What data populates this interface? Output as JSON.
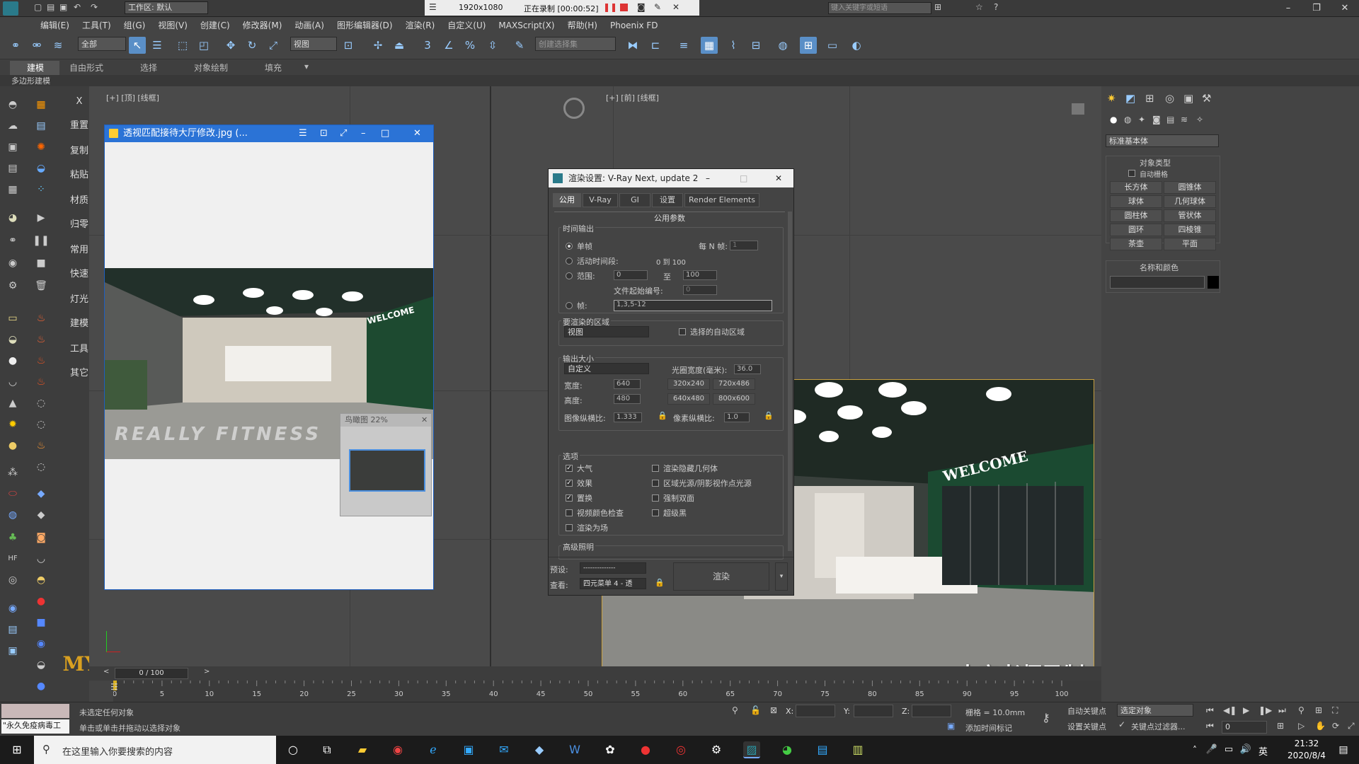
{
  "titlebar": {
    "workspace_label": "工作区: 默认",
    "resolution": "1920x1080",
    "recording": "正在录制 [00:00:52]",
    "search_placeholder": "键入关键字或短语"
  },
  "menus": [
    "编辑(E)",
    "工具(T)",
    "组(G)",
    "视图(V)",
    "创建(C)",
    "修改器(M)",
    "动画(A)",
    "图形编辑器(D)",
    "渲染(R)",
    "自定义(U)",
    "MAXScript(X)",
    "帮助(H)",
    "Phoenix FD"
  ],
  "toolbar": {
    "filter_value": "全部",
    "ref_coord_value": "视图",
    "selection_set_placeholder": "创建选择集"
  },
  "ribbon": {
    "tabs": [
      "建模",
      "自由形式",
      "选择",
      "对象绘制",
      "填充"
    ],
    "subtitle": "多边形建模"
  },
  "left_labels": [
    "重置",
    "复制",
    "粘贴",
    "材质",
    "归零",
    "常用",
    "快速",
    "灯光",
    "建模",
    "工具",
    "其它"
  ],
  "left_close": "X",
  "viewport": {
    "left_label": "[+] [顶] [线框]",
    "right_label": "[+] [前] [线框]",
    "watermark": "大宇老师录制",
    "logo": "MY"
  },
  "image_window": {
    "title": "透视匹配接待大厅修改.jpg  (...",
    "navigator_title": "鸟瞰图 22%",
    "scene_text": "REALLY FITNESS",
    "scene_welcome": "WELCOME"
  },
  "vray": {
    "title": "渲染设置: V-Ray Next, update 2",
    "tabs": [
      "公用",
      "V-Ray",
      "GI",
      "设置",
      "Render Elements"
    ],
    "section": "公用参数",
    "time_output": {
      "group": "时间输出",
      "single": "单帧",
      "every_n": "每 N 帧:",
      "every_n_value": "1",
      "active_segment": "活动时间段:",
      "active_range": "0 到 100",
      "range": "范围:",
      "range_from": "0",
      "range_to_label": "至",
      "range_to": "100",
      "file_start": "文件起始编号:",
      "file_start_value": "0",
      "frames": "帧:",
      "frames_value": "1,3,5-12"
    },
    "area": {
      "group": "要渲染的区域",
      "value": "视图",
      "auto_region": "选择的自动区域"
    },
    "output_size": {
      "group": "输出大小",
      "preset": "自定义",
      "aperture_label": "光圈宽度(毫米):",
      "aperture_value": "36.0",
      "width_label": "宽度:",
      "width_value": "640",
      "height_label": "高度:",
      "height_value": "480",
      "presets": [
        "320x240",
        "720x486",
        "640x480",
        "800x600"
      ],
      "image_aspect_label": "图像纵横比:",
      "image_aspect_value": "1.333",
      "pixel_aspect_label": "像素纵横比:",
      "pixel_aspect_value": "1.0"
    },
    "options": {
      "group": "选项",
      "left": [
        {
          "label": "大气",
          "checked": true
        },
        {
          "label": "效果",
          "checked": true
        },
        {
          "label": "置换",
          "checked": true
        },
        {
          "label": "视频颜色检查",
          "checked": false
        },
        {
          "label": "渲染为场",
          "checked": false
        }
      ],
      "right": [
        {
          "label": "渲染隐藏几何体",
          "checked": false
        },
        {
          "label": "区域光源/阴影视作点光源",
          "checked": false
        },
        {
          "label": "强制双面",
          "checked": false
        },
        {
          "label": "超级黑",
          "checked": false
        }
      ]
    },
    "advanced": "高级照明",
    "preset_label": "预设:",
    "preset_value": "--------------",
    "view_label": "查看:",
    "view_value": "四元菜单 4 - 透",
    "render_button": "渲染"
  },
  "command_panel": {
    "dropdown": "标准基本体",
    "object_type": "对象类型",
    "auto_grid": "自动栅格",
    "objects": [
      "长方体",
      "圆锥体",
      "球体",
      "几何球体",
      "圆柱体",
      "管状体",
      "圆环",
      "四棱锥",
      "茶壶",
      "平面"
    ],
    "name_color": "名称和颜色"
  },
  "timeline": {
    "frame": "0 / 100",
    "ticks": [
      "0",
      "5",
      "10",
      "15",
      "20",
      "25",
      "30",
      "35",
      "40",
      "45",
      "50",
      "55",
      "60",
      "65",
      "70",
      "75",
      "80",
      "85",
      "90",
      "95",
      "100"
    ]
  },
  "status": {
    "status_top": "未选定任何对象",
    "status_bottom": "单击或单击并拖动以选择对象",
    "left_badge": "\"永久免疫病毒工",
    "x_label": "X:",
    "y_label": "Y:",
    "z_label": "Z:",
    "grid": "栅格 = 10.0mm",
    "auto_key": "自动关键点",
    "set_key": "设置关键点",
    "selected_object": "选定对象",
    "key_filter": "关键点过滤器...",
    "add_time_tag": "添加时间标记",
    "frame_field": "0"
  },
  "taskbar": {
    "search_placeholder": "在这里输入你要搜索的内容",
    "time": "21:32",
    "date": "2020/8/4",
    "ime": "英"
  }
}
